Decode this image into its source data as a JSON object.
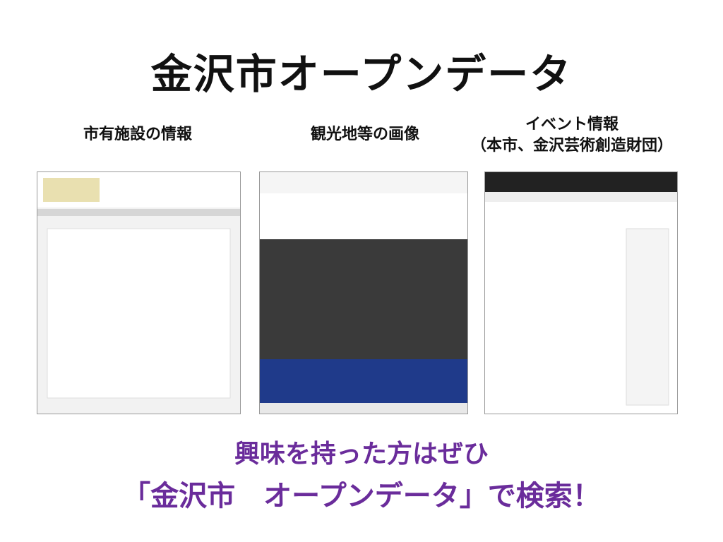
{
  "title": "金沢市オープンデータ",
  "columns": [
    {
      "label": "市有施設の情報"
    },
    {
      "label": "観光地等の画像"
    },
    {
      "label_line1": "イベント情報",
      "label_line2": "（本市、金沢芸術創造財団）"
    }
  ],
  "footer": {
    "line1": "興味を持った方はぜひ",
    "line2": "「金沢市　オープンデータ」で検索！"
  },
  "colors": {
    "accent": "#6a2c9b",
    "text": "#111111"
  }
}
